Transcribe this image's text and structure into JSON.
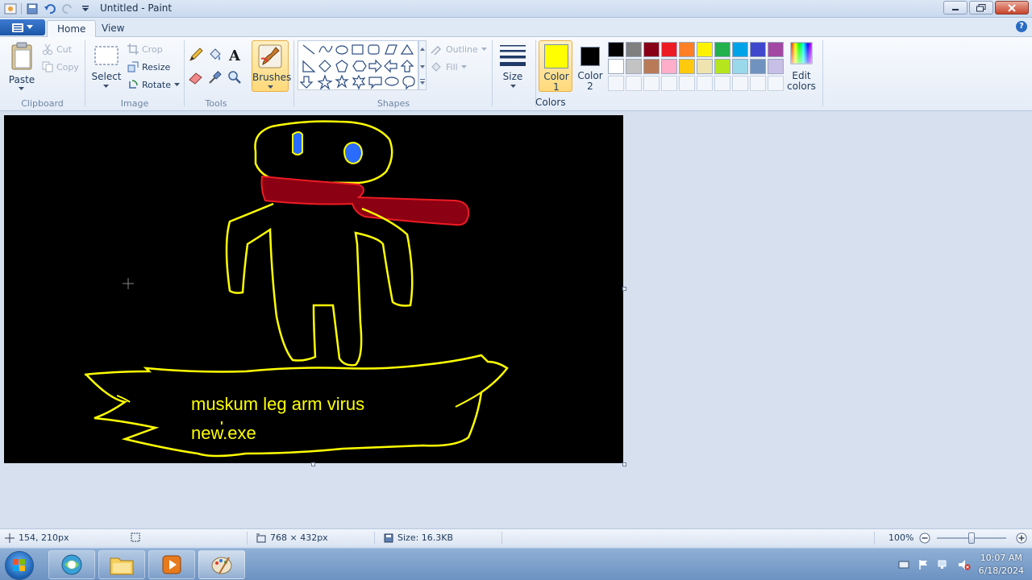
{
  "window": {
    "title": "Untitled - Paint"
  },
  "tabs": {
    "app_menu": "",
    "home": "Home",
    "view": "View"
  },
  "clipboard": {
    "paste": "Paste",
    "cut": "Cut",
    "copy": "Copy",
    "group": "Clipboard"
  },
  "image": {
    "select": "Select",
    "crop": "Crop",
    "resize": "Resize",
    "rotate": "Rotate",
    "group": "Image"
  },
  "tools": {
    "group": "Tools"
  },
  "brushes": {
    "label": "Brushes"
  },
  "shapes": {
    "group": "Shapes",
    "outline": "Outline",
    "fill": "Fill"
  },
  "size": {
    "label": "Size"
  },
  "colors": {
    "color1_label": "Color",
    "color1_num": "1",
    "color2_label": "Color",
    "color2_num": "2",
    "edit_label_1": "Edit",
    "edit_label_2": "colors",
    "group": "Colors",
    "color1": "#ffff00",
    "color2": "#000000",
    "palette": [
      "#000000",
      "#7f7f7f",
      "#880015",
      "#ed1c24",
      "#ff7f27",
      "#fff200",
      "#22b14c",
      "#00a2e8",
      "#3f48cc",
      "#a349a4",
      "#ffffff",
      "#c3c3c3",
      "#b97a57",
      "#ffaec9",
      "#ffc90e",
      "#efe4b0",
      "#b5e61d",
      "#99d9ea",
      "#7092be",
      "#c8bfe7",
      "#ffffff",
      "#ffffff",
      "#ffffff",
      "#ffffff",
      "#ffffff",
      "#ffffff",
      "#ffffff",
      "#ffffff",
      "#ffffff",
      "#ffffff"
    ]
  },
  "drawing": {
    "line1": "muskum leg arm virus",
    "line2": "new.exe",
    "ghost": "muskum",
    "stroke_color": "#ffff00",
    "scarf_color": "#8b0012",
    "eye_color": "#2a6cff"
  },
  "status": {
    "cursor_pos": "154, 210px",
    "dimensions": "768 × 432px",
    "size": "Size: 16.3KB",
    "zoom": "100%",
    "zoom_level": 0.5
  },
  "taskbar": {
    "time": "10:07 AM",
    "date": "6/18/2024"
  }
}
